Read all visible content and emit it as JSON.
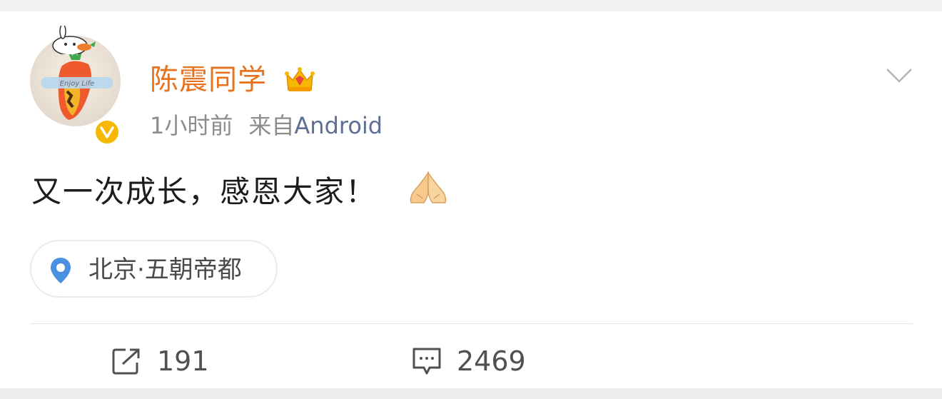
{
  "post": {
    "username": "陈震同学",
    "time": "1小时前",
    "source_prefix": "来自",
    "source_name": "Android",
    "text": "又一次成长，感恩大家！",
    "location": "北京·五朝帝都"
  },
  "actions": {
    "repost_count": "191",
    "comment_count": "2469"
  },
  "colors": {
    "username": "#e8731f",
    "source": "#5d6f94",
    "badge": "#f6b800",
    "location_pin": "#4a90e2"
  },
  "icons": {
    "crown": "crown-icon",
    "chevron": "chevron-down-icon",
    "location": "location-pin-icon",
    "repost": "repost-icon",
    "comment": "comment-icon",
    "pray": "pray-hands-emoji"
  }
}
